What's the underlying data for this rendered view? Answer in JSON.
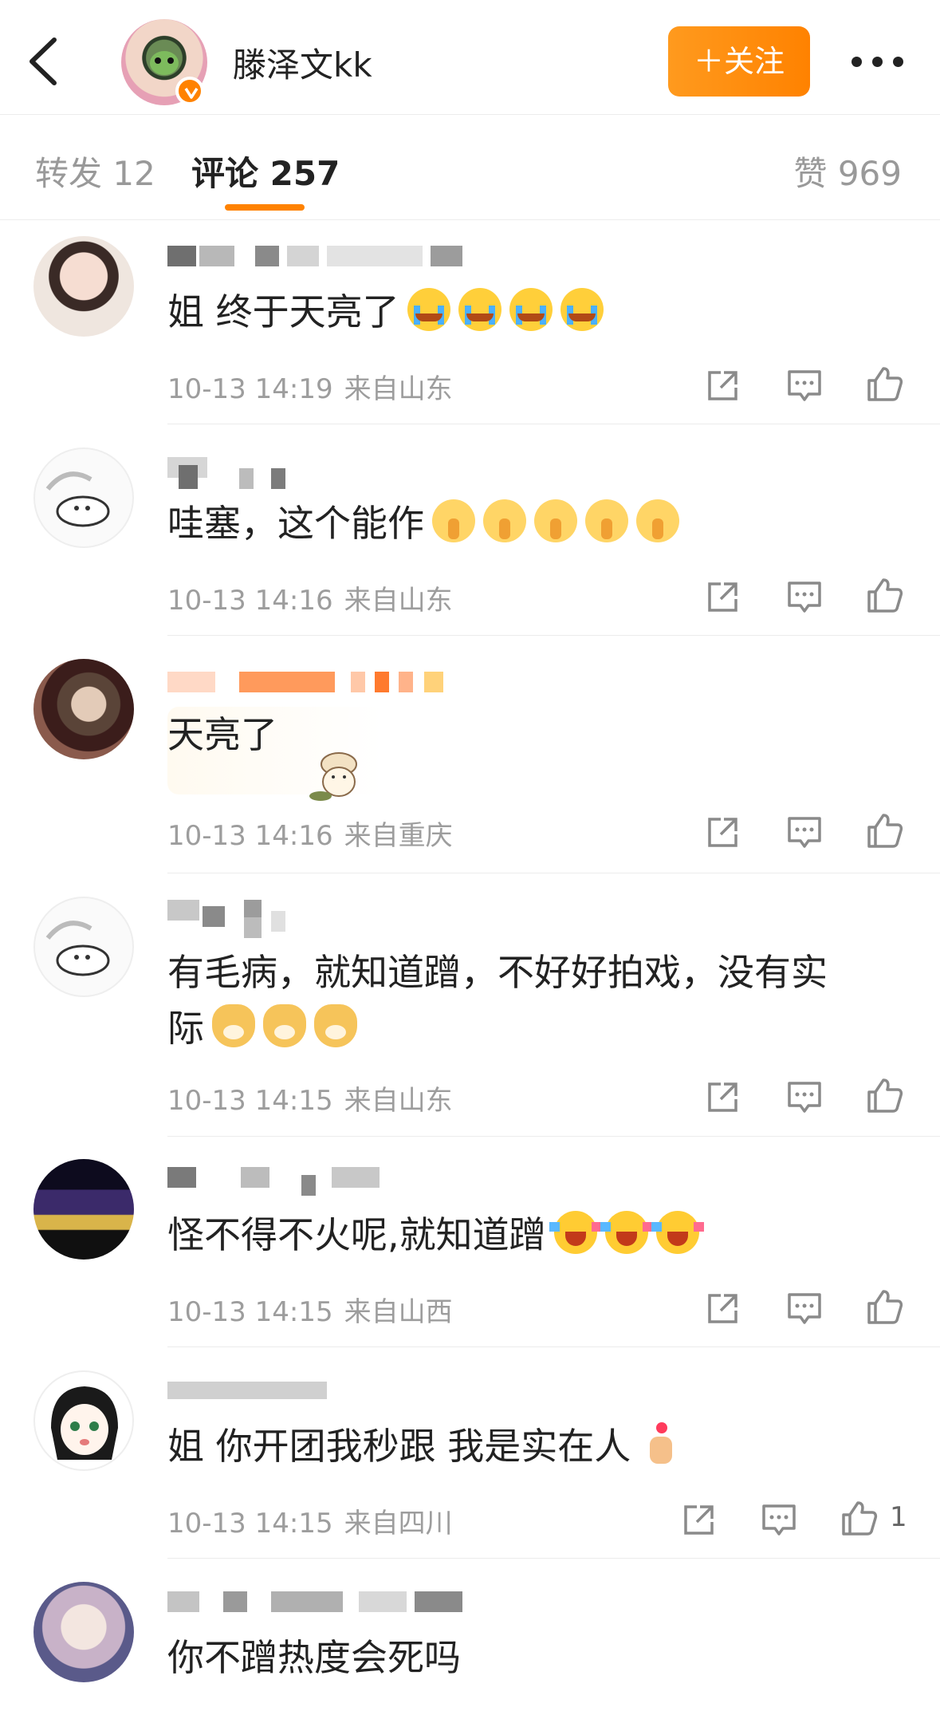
{
  "header": {
    "user_name": "滕泽文kk",
    "follow_label": "＋关注"
  },
  "tabs": {
    "repost": "转发 12",
    "comment": "评论 257",
    "like": "赞 969"
  },
  "comments": [
    {
      "text": "姐 终于天亮了",
      "emojis": [
        "crying-face",
        "crying-face",
        "crying-face",
        "crying-face"
      ],
      "time": "10-13 14:19",
      "location": "来自山东"
    },
    {
      "text": "哇塞，这个能作",
      "emojis": [
        "pleading-face",
        "pleading-face",
        "pleading-face",
        "pleading-face",
        "pleading-face"
      ],
      "time": "10-13 14:16",
      "location": "来自山东"
    },
    {
      "text": "天亮了",
      "emojis": [],
      "sticker": "bear-sticker",
      "time": "10-13 14:16",
      "location": "来自重庆"
    },
    {
      "text_line1": "有毛病，就知道蹭，不好好拍戏，没有实",
      "text_line2": "际",
      "emojis": [
        "doge-face",
        "doge-face",
        "doge-face"
      ],
      "time": "10-13 14:15",
      "location": "来自山东"
    },
    {
      "text": "怪不得不火呢,就知道蹭",
      "emojis": [
        "laughing-face",
        "laughing-face",
        "laughing-face"
      ],
      "time": "10-13 14:15",
      "location": "来自山西"
    },
    {
      "text": "姐 你开团我秒跟 我是实在人",
      "emojis": [
        "finger-heart"
      ],
      "time": "10-13 14:15",
      "location": "来自四川",
      "like_count": "1"
    },
    {
      "text": "你不蹭热度会死吗"
    }
  ],
  "icons": {
    "back": "chevron-left-icon",
    "more": "more-dots-icon",
    "share": "share-icon",
    "comment": "comment-icon",
    "like": "thumbs-up-icon",
    "verified": "verified-badge-icon"
  },
  "colors": {
    "accent": "#ff8200",
    "meta_text": "#9d9d9d",
    "divider": "#ececec"
  }
}
